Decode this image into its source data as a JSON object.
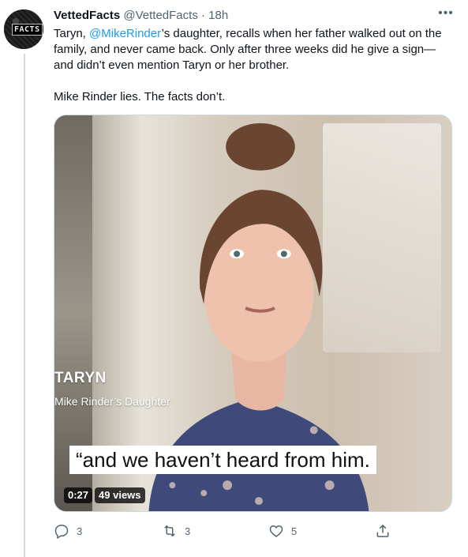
{
  "tweet": {
    "author_name": "VettedFacts",
    "handle": "@VettedFacts",
    "separator": "·",
    "time": "18h",
    "avatar_text": "FACTS",
    "text_line1_before": "Taryn, ",
    "mention": "@MikeRinder",
    "text_line1_after": "’s daughter, recalls when her father walked out on the family, and never came back. Only after three weeks did he give a sign—and didn’t even mention Taryn or her brother.",
    "text_line2": "Mike Rinder lies. The facts don’t.",
    "more_icon": "more-horizontal-icon"
  },
  "media": {
    "lower_third_name": "TARYN",
    "lower_third_role": "Mike Rinder’s Daughter",
    "caption": "“and we haven’t heard from him.",
    "duration": "0:27",
    "views": "49 views"
  },
  "actions": {
    "reply_count": "3",
    "retweet_count": "3",
    "like_count": "5",
    "reply_icon": "reply-icon",
    "retweet_icon": "retweet-icon",
    "like_icon": "heart-icon",
    "share_icon": "share-icon"
  }
}
